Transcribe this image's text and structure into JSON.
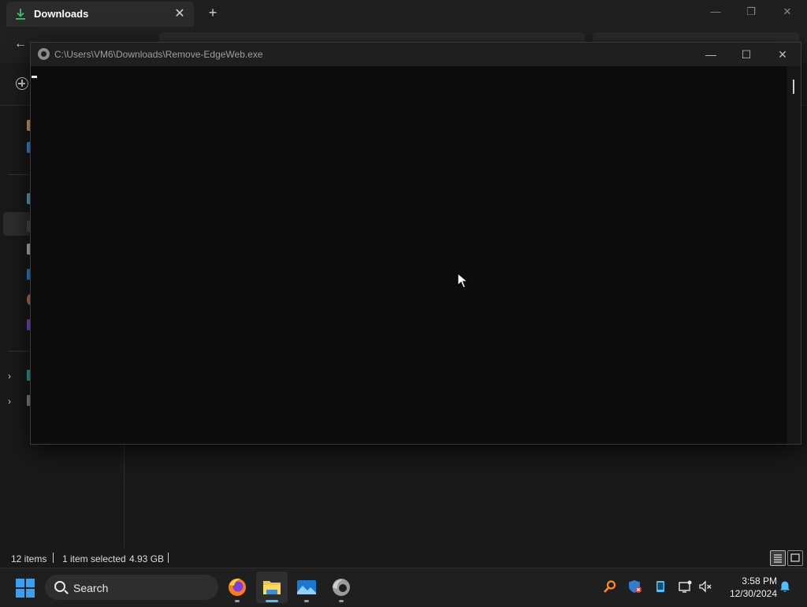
{
  "explorer": {
    "tab_title": "Downloads",
    "tab_close": "✕",
    "new_tab": "+",
    "window_controls": {
      "minimize": "—",
      "maximize": "❐",
      "close": "✕"
    },
    "nav": {
      "back": "←"
    },
    "status": {
      "item_count": "12 items",
      "selection": "1 item selected",
      "size": "4.93 GB"
    }
  },
  "console": {
    "title": "C:\\Users\\VM6\\Downloads\\Remove-EdgeWeb.exe",
    "controls": {
      "minimize": "—",
      "maximize": "☐",
      "close": "✕"
    }
  },
  "taskbar": {
    "search_label": "Search",
    "apps": [
      "firefox",
      "file-explorer",
      "photos",
      "edge"
    ],
    "clock": {
      "time": "3:58 PM",
      "date": "12/30/2024"
    }
  },
  "colors": {
    "accent": "#4cc2ff",
    "start": "#3aa0f2",
    "console_bg": "#0c0c0c",
    "downloads_icon": "#35c46a"
  }
}
